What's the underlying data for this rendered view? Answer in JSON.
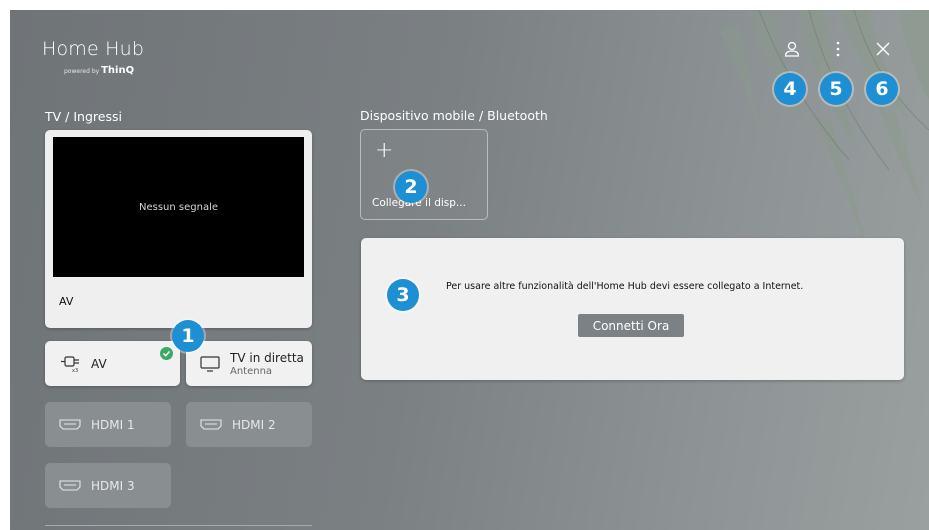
{
  "brand": {
    "title": "Home Hub",
    "powered_by": "powered by ",
    "powered_brand": "ThinQ"
  },
  "tv_inputs": {
    "section_label": "TV / Ingressi",
    "preview": {
      "screen_text": "Nessun segnale",
      "label": "AV"
    },
    "inputs": [
      {
        "name": "AV",
        "sub": "",
        "icon": "av-input-icon",
        "selected": true
      },
      {
        "name": "TV in diretta",
        "sub": "Antenna",
        "icon": "tv-monitor-icon",
        "selected": false
      },
      {
        "name": "HDMI 1",
        "sub": "",
        "icon": "hdmi-icon",
        "selected": false
      },
      {
        "name": "HDMI 2",
        "sub": "",
        "icon": "hdmi-icon",
        "selected": false
      },
      {
        "name": "HDMI 3",
        "sub": "",
        "icon": "hdmi-icon",
        "selected": false
      }
    ]
  },
  "mobile": {
    "section_label": "Dispositivo mobile / Bluetooth",
    "add_label": "Collegare il disp..."
  },
  "network": {
    "message": "Per usare altre funzionalità dell'Home Hub devi essere collegato a Internet.",
    "button_label": "Connetti Ora"
  },
  "header_icons": [
    "user-icon",
    "more-icon",
    "close-icon"
  ],
  "markers": [
    "1",
    "2",
    "3",
    "4",
    "5",
    "6"
  ],
  "colors": {
    "marker": "#1e8fd2",
    "check": "#3aa967",
    "background": "#7b8083"
  }
}
